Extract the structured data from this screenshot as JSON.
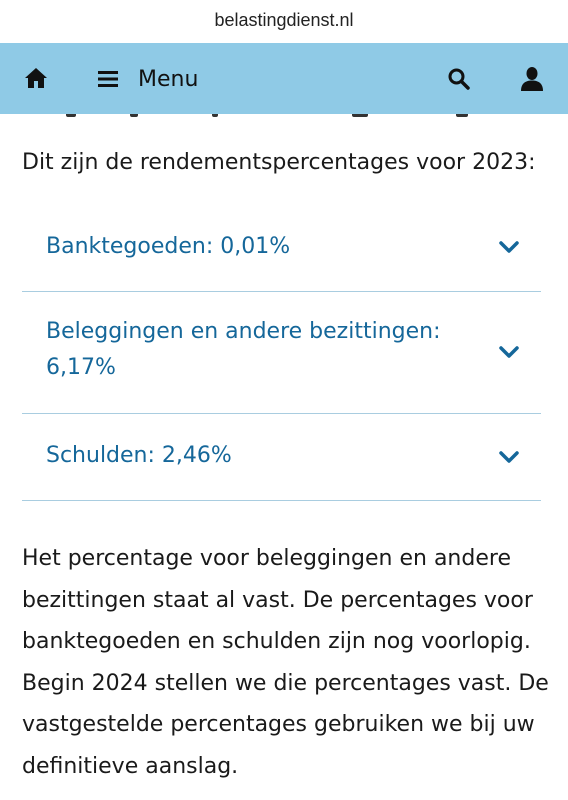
{
  "browser": {
    "url": "belastingdienst.nl"
  },
  "navbar": {
    "home_icon": "home-icon",
    "menu_icon": "hamburger-icon",
    "menu_label": "Menu",
    "search_icon": "search-icon",
    "user_icon": "user-icon",
    "background_color": "#8fcae6"
  },
  "content": {
    "intro": "Dit zijn de rendementspercentages voor 2023:",
    "accordion": [
      {
        "label": "Banktegoeden: 0,01%",
        "expanded": false
      },
      {
        "label": "Beleggingen en andere bezittingen: 6,17%",
        "expanded": false
      },
      {
        "label": "Schulden: 2,46%",
        "expanded": false
      }
    ],
    "paragraph": "Het percentage voor beleggingen en andere bezittingen staat al vast. De percentages voor banktegoeden en schulden zijn nog voorlopig. Begin 2024 stellen we die percentages vast. De vastgestelde percentages gebruiken we bij uw definitieve aanslag.",
    "link_color": "#15679a",
    "divider_color": "#a9cde0"
  }
}
